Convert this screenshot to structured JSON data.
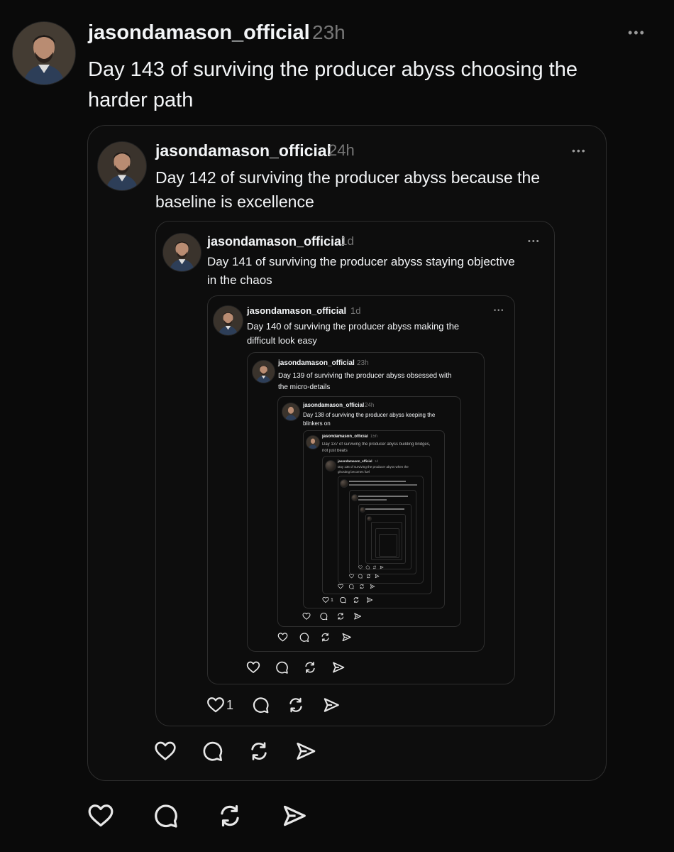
{
  "posts": [
    {
      "username": "jasondamason_official",
      "time": "23h",
      "text_line1": "Day 143 of surviving the producer abyss choosing the",
      "text_line2": "harder path"
    },
    {
      "username": "jasondamason_official",
      "time": "24h",
      "text_line1": "Day 142 of surviving the producer abyss because the",
      "text_line2": "baseline is excellence"
    },
    {
      "username": "jasondamason_official",
      "time": "1d",
      "text_line1": "Day 141 of surviving the producer abyss staying objective",
      "text_line2": "in the chaos",
      "likes": "1"
    },
    {
      "username": "jasondamason_official",
      "time": "1d",
      "text_line1": "Day 140 of surviving the producer abyss making the",
      "text_line2": "difficult look easy"
    },
    {
      "username": "jasondamason_official",
      "time": "23h",
      "text_line1": "Day 139 of surviving the producer abyss obsessed with",
      "text_line2": "the micro-details"
    },
    {
      "username": "jasondamason_official",
      "time": "24h",
      "text_line1": "Day 138 of surviving the producer abyss keeping the",
      "text_line2": "blinkers on"
    },
    {
      "username": "jasondamason_official",
      "time": "15h",
      "text_line1": "Day 137 of surviving the producer abyss building bridges,",
      "text_line2": "not just beats",
      "likes": "1"
    },
    {
      "username": "jasondamason_official",
      "time": "1d",
      "text_line1": "Day 136 of surviving the producer abyss when the",
      "text_line2": "ghosting becomes fuel"
    }
  ],
  "more_label": "•••",
  "colors": {
    "background": "#0a0a0a",
    "text": "#f3f5f7",
    "muted": "#777777",
    "border": "#2e2e2e"
  },
  "icons": [
    "heart-icon",
    "comment-icon",
    "repost-icon",
    "share-icon",
    "more-icon",
    "avatar"
  ]
}
